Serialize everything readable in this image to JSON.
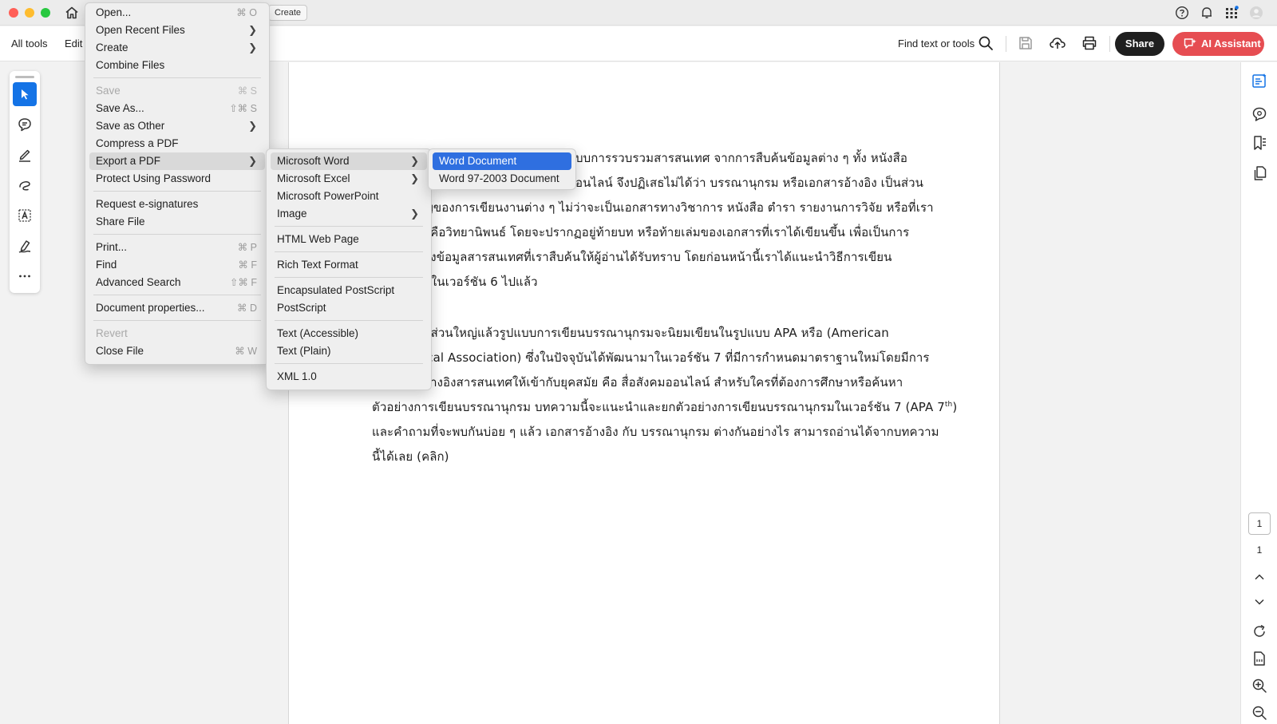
{
  "toolbar": {
    "all_tools": "All tools",
    "edit": "Edit",
    "create_chip": "Create",
    "find_text": "Find text or tools",
    "share": "Share",
    "ai_assistant": "AI Assistant"
  },
  "main_menu": {
    "items": [
      {
        "label": "Open...",
        "shortcut": "⌘ O"
      },
      {
        "label": "Open Recent Files"
      },
      {
        "label": "Create"
      },
      {
        "label": "Combine Files"
      },
      {
        "label": "Save",
        "shortcut": "⌘ S"
      },
      {
        "label": "Save As...",
        "shortcut": "⇧⌘ S"
      },
      {
        "label": "Save as Other"
      },
      {
        "label": "Compress a PDF"
      },
      {
        "label": "Export a PDF"
      },
      {
        "label": "Protect Using Password"
      },
      {
        "label": "Request e-signatures"
      },
      {
        "label": "Share File"
      },
      {
        "label": "Print...",
        "shortcut": "⌘ P"
      },
      {
        "label": "Find",
        "shortcut": "⌘ F"
      },
      {
        "label": "Advanced Search",
        "shortcut": "⇧⌘ F"
      },
      {
        "label": "Document properties...",
        "shortcut": "⌘ D"
      },
      {
        "label": "Revert"
      },
      {
        "label": "Close File",
        "shortcut": "⌘ W"
      }
    ]
  },
  "export_menu": {
    "items": [
      {
        "label": "Microsoft Word"
      },
      {
        "label": "Microsoft Excel"
      },
      {
        "label": "Microsoft PowerPoint"
      },
      {
        "label": "Image"
      },
      {
        "label": "HTML Web Page"
      },
      {
        "label": "Rich Text Format"
      },
      {
        "label": "Encapsulated PostScript"
      },
      {
        "label": "PostScript"
      },
      {
        "label": "Text (Accessible)"
      },
      {
        "label": "Text (Plain)"
      },
      {
        "label": "XML 1.0"
      }
    ]
  },
  "word_menu": {
    "items": [
      {
        "label": "Word Document"
      },
      {
        "label": "Word 97-2003 Document"
      }
    ]
  },
  "document": {
    "lines": [
      "บบการรวบรวมสารสนเทศ จากการสืบค้นข้อมูลต่าง ๆ ทั้ง หนังสือ",
      "อนไลน์ จึงปฏิเสธไม่ได้ว่า บรรณานุกรม หรือเอกสารอ้างอิง เป็นส่วน",
      "ญของการเขียนงานต่าง ๆ ไม่ว่าจะเป็นเอกสารทางวิชาการ หนังสือ ตำรา รายงานการวิจัย หรือที่เรา",
      "ก็คือวิทยานิพนธ์ โดยจะปรากฏอยู่ท้ายบท หรือท้ายเล่มของเอกสารที่เราได้เขียนขึ้น เพื่อเป็นการ",
      "ล่งข้อมูลสารสนเทศที่เราสืบค้นให้ผู้อ่านได้รับทราบ โดยก่อนหน้านี้เราได้แนะนำวิธีการเขียน",
      "มในเวอร์ชัน 6 ไปแล้ว",
      "บส่วนใหญ่แล้วรูปแบบการเขียนบรรณานุกรมจะนิยมเขียนในรูปแบบ APA หรือ (American",
      "ical Association) ซึ่งในปัจจุบันได้พัฒนามาในเวอร์ชัน 7 ที่มีการกำหนดมาตราฐานใหม่โดยมีการ",
      "อ้างอิงสารสนเทศให้เข้ากับยุคสมัย คือ สื่อสังคมออนไลน์ สำหรับใครที่ต้องการศึกษาหรือค้นหา",
      "ตัวอย่างการเขียนบรรณานุกรม บทความนี้จะแนะนำและยกตัวอย่างการเขียนบรรณานุกรมในเวอร์ชัน 7 (APA 7",
      "และคำถามที่จะพบกันบ่อย ๆ แล้ว เอกสารอ้างอิง กับ บรรณานุกรม ต่างกันอย่างไร สามารถอ่านได้จากบทความ",
      "นี้ได้เลย (คลิก)"
    ],
    "superscript": "th",
    "close_paren": ")"
  },
  "pager": {
    "current": "1",
    "total": "1"
  },
  "colors": {
    "accent": "#1473e6",
    "menu_selection": "#2f6fe0",
    "ai_button": "#e64d52",
    "share_button": "#1f1f1f"
  }
}
